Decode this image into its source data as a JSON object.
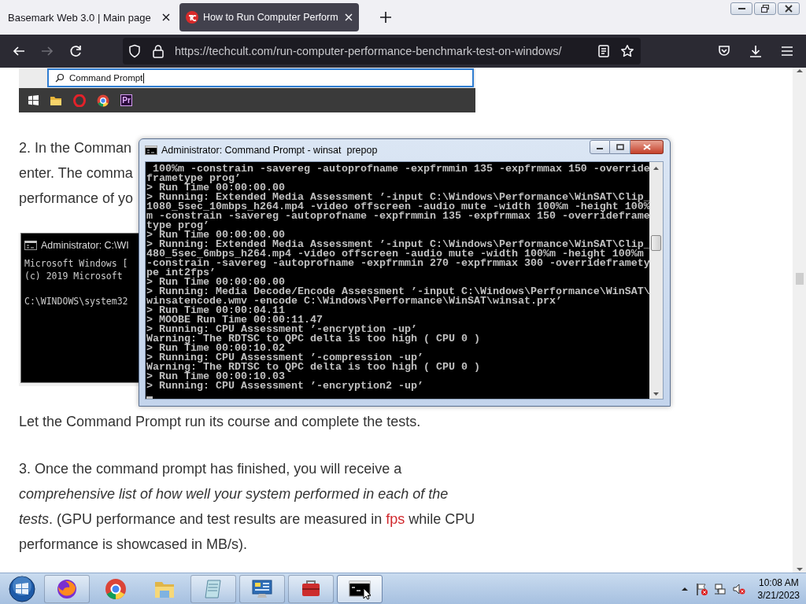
{
  "browser": {
    "tabs": [
      {
        "label": "Basemark Web 3.0 | Main page",
        "selected": false
      },
      {
        "label": "How to Run Computer Perform",
        "selected": true
      }
    ],
    "nav": {
      "forward_disabled": true,
      "url": "https://techcult.com/run-computer-performance-benchmark-test-on-windows/"
    }
  },
  "article": {
    "top_screenshot": {
      "search_value": "Command Prompt",
      "app_label": "Pr"
    },
    "step2_lines": [
      "2. In the Comman",
      "enter. The comma",
      "performance of yo"
    ],
    "cmd_screenshot": {
      "title": "Administrator: C:\\WI",
      "blocks": [
        [
          "Microsoft Windows [",
          "(c) 2019 Microsoft"
        ],
        [
          "C:\\WINDOWS\\system32"
        ]
      ]
    },
    "note": "Let the Command Prompt run its course and complete the tests.",
    "step3": {
      "before": "3. Once the command prompt has finished,  you will receive a *comprehensive list of how well your system performed in each of the tests*. (GPU performance and test results are measured in",
      "link": "fps",
      "after": "while CPU performance is showcased in MB/s)."
    }
  },
  "cmd_window": {
    "title": "Administrator: Command Prompt - winsat  prepop",
    "lines": [
      " 100%m -constrain -savereg -autoprofname -expfrmmin 135 -expfrmmax 150 -override",
      "frametype prog’",
      "> Run Time 00:00:00.00",
      "> Running: Extended Media Assessment ’-input C:\\Windows\\Performance\\WinSAT\\Clip_",
      "1080_5sec_10mbps_h264.mp4 -video offscreen -audio mute -width 100%m -height 100%",
      "m -constrain -savereg -autoprofname -expfrmmin 135 -expfrmmax 150 -overrideframe",
      "type prog’",
      "> Run Time 00:00:00.00",
      "> Running: Extended Media Assessment ’-input C:\\Windows\\Performance\\WinSAT\\Clip_",
      "480_5sec_6mbps_h264.mp4 -video offscreen -audio mute -width 100%m -height 100%m",
      "-constrain -savereg -autoprofname -expfrmmin 270 -expfrmmax 300 -overrideframety",
      "pe int2fps’",
      "> Run Time 00:00:00.00",
      "> Running: Media Decode/Encode Assessment ’-input C:\\Windows\\Performance\\WinSAT\\",
      "winsatencode.wmv -encode C:\\Windows\\Performance\\WinSAT\\winsat.prx’",
      "> Run Time 00:00:04.11",
      "> MOOBE Run Time 00:00:11.47",
      "> Running: CPU Assessment ’-encryption -up’",
      "Warning: The RDTSC to QPC delta is too high ( CPU 0 )",
      "> Run Time 00:00:10.02",
      "> Running: CPU Assessment ’-compression -up’",
      "Warning: The RDTSC to QPC delta is too high ( CPU 0 )",
      "> Run Time 00:00:10.03",
      "> Running: CPU Assessment ’-encryption2 -up’"
    ]
  },
  "taskbar": {
    "buttons": [
      {
        "selected": false
      },
      {
        "selected": false
      },
      {
        "selected": false
      },
      {
        "selected": false
      },
      {
        "selected": false
      },
      {
        "selected": false
      },
      {
        "selected": true
      }
    ],
    "clock": {
      "time": "10:08 AM",
      "date": "3/21/2023"
    }
  }
}
